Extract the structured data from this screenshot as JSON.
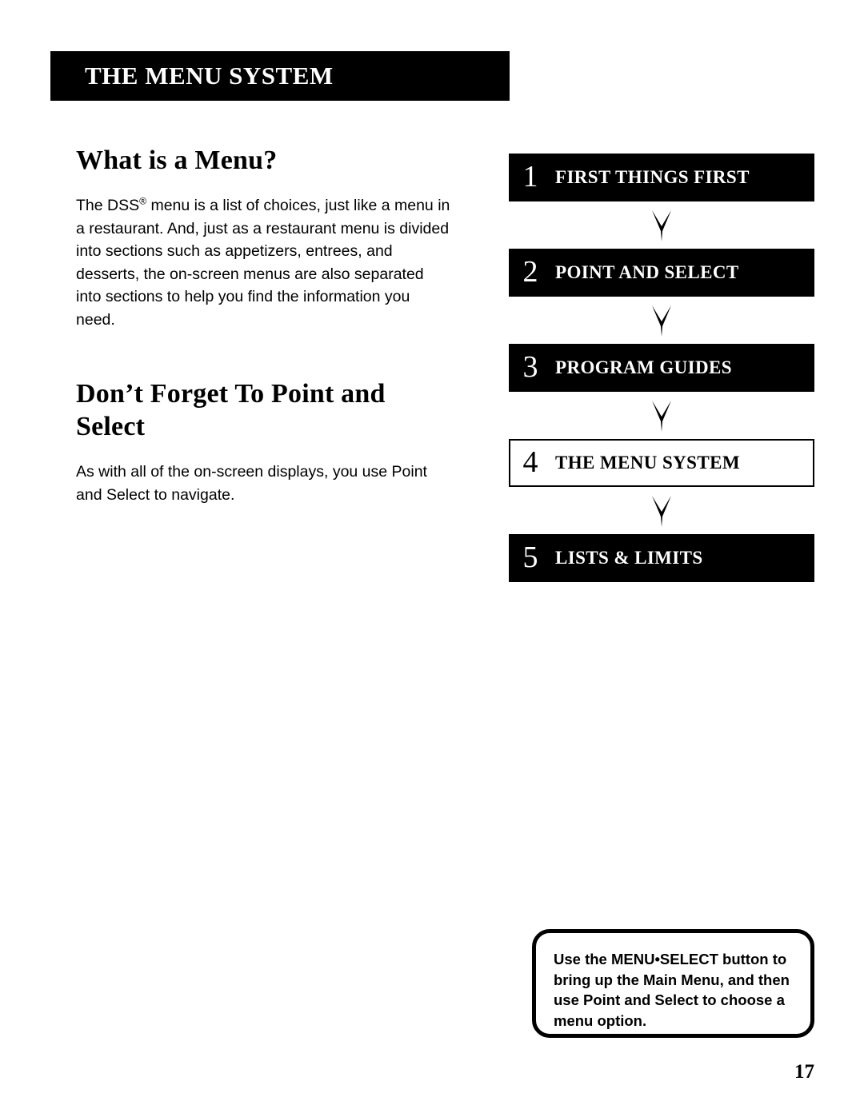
{
  "chapter": {
    "title": "THE MENU SYSTEM"
  },
  "sections": [
    {
      "heading": "What is a Menu?",
      "body_before_mark": "The DSS",
      "trademark": "®",
      "body_after_mark": " menu is a list of choices, just like a menu in a restaurant. And, just as a restaurant menu is divided into sections such as appetizers, entrees, and desserts, the on-screen menus are also separated into sections to help you find the information you need."
    },
    {
      "heading": "Don’t Forget To Point and Select",
      "body": "As with all of the on-screen displays, you use Point and Select to navigate."
    }
  ],
  "flowchart": {
    "steps": [
      {
        "number": "1",
        "label": "FIRST THINGS FIRST",
        "current": false
      },
      {
        "number": "2",
        "label": "POINT AND SELECT",
        "current": false
      },
      {
        "number": "3",
        "label": "PROGRAM GUIDES",
        "current": false
      },
      {
        "number": "4",
        "label": "THE MENU SYSTEM",
        "current": true
      },
      {
        "number": "5",
        "label": "LISTS & LIMITS",
        "current": true
      }
    ],
    "connector_icon": "chevron-down-arrow-icon"
  },
  "callout": {
    "text": "Use the MENU•SELECT button to bring up the Main Menu, and then use Point and Select to choose a menu option."
  },
  "page": {
    "number": "17"
  },
  "colors": {
    "ink": "#000000",
    "paper": "#ffffff"
  }
}
